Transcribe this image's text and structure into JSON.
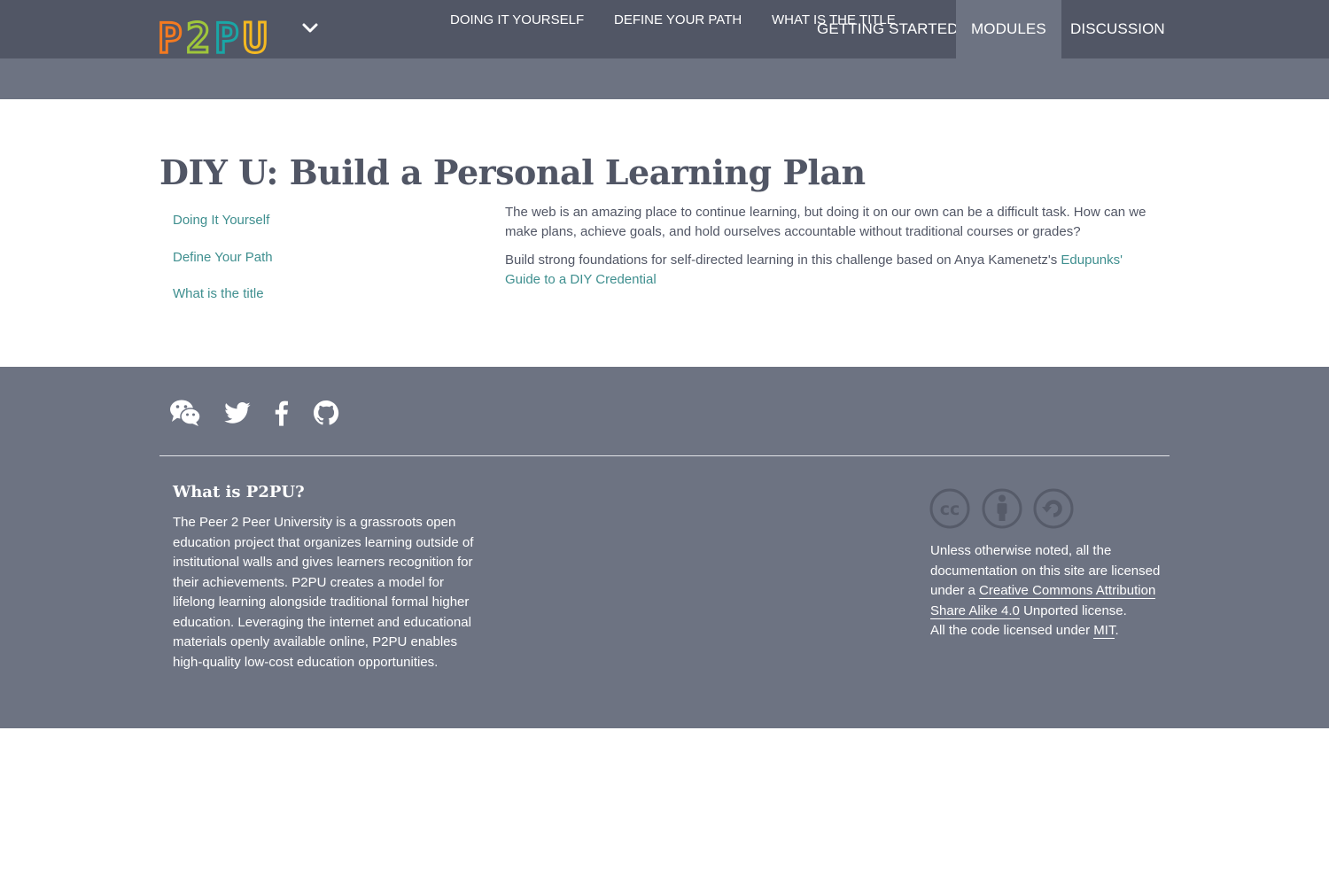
{
  "header": {
    "logo_text": "P2PU",
    "nav": [
      {
        "label": "Getting Started"
      },
      {
        "label": "Modules"
      },
      {
        "label": "Discussion"
      }
    ]
  },
  "subnav": [
    {
      "label": "Doing it yourself"
    },
    {
      "label": "Define your path"
    },
    {
      "label": "What is the title"
    }
  ],
  "main": {
    "title": "DIY U: Build a Personal Learning Plan",
    "sidebar": [
      {
        "label": "Doing It Yourself"
      },
      {
        "label": "Define Your Path"
      },
      {
        "label": "What is the title"
      }
    ],
    "para1": "The web is an amazing place to continue learning, but doing it on our own can be a difficult task. How can we make plans, achieve goals, and hold ourselves accountable without traditional courses or grades?",
    "para2_text": "Build strong foundations for self-directed learning in this challenge based on Anya Kamenetz's ",
    "para2_link": "Edupunks' Guide to a DIY Credential"
  },
  "footer": {
    "social_icons": [
      "wechat-icon",
      "twitter-icon",
      "facebook-icon",
      "github-icon"
    ],
    "about_title": "What is P2PU?",
    "about_text": "The Peer 2 Peer University is a grassroots open education project that organizes learning outside of institutional walls and gives learners recognition for their achievements. P2PU creates a model for lifelong learning alongside traditional formal higher education. Leveraging the internet and educational materials openly available online, P2PU enables high-quality low-cost education opportunities.",
    "cc_icons": [
      "cc-icon",
      "by-icon",
      "sa-icon"
    ],
    "license_pre": "Unless otherwise noted, all the documentation on this site are licensed under a ",
    "license_link": "Creative Commons Attribution Share Alike 4.0",
    "license_post": " Unported license.",
    "code_pre": "All the code licensed under ",
    "code_link": "MIT",
    "code_post": "."
  },
  "colors": {
    "header_bg": "#515665",
    "subnav_bg": "#6d7382",
    "link": "#3f8f8f",
    "logo_orange": "#f47a20",
    "logo_green": "#9fc63b",
    "logo_teal": "#1aa6a6",
    "logo_yellow": "#f5b921"
  }
}
